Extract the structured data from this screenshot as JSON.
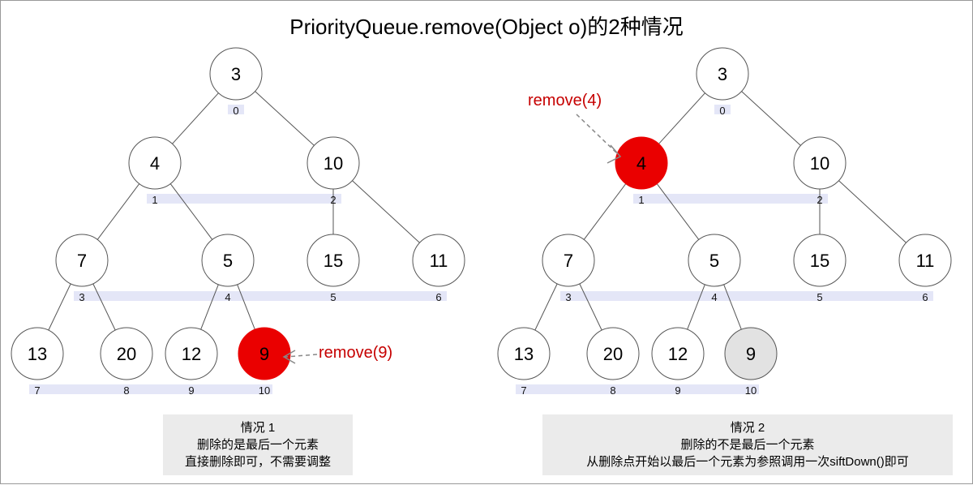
{
  "title": "PriorityQueue.remove(Object o)的2种情况",
  "left": {
    "nodes": [
      "3",
      "4",
      "10",
      "7",
      "5",
      "15",
      "11",
      "13",
      "20",
      "12",
      "9"
    ],
    "highlight_index": 10,
    "annotation": "remove(9)",
    "caption_title": "情况 1",
    "caption_line1": "删除的是最后一个元素",
    "caption_line2": "直接删除即可，不需要调整"
  },
  "right": {
    "nodes": [
      "3",
      "4",
      "10",
      "7",
      "5",
      "15",
      "11",
      "13",
      "20",
      "12",
      "9"
    ],
    "highlight_index": 1,
    "grey_index": 10,
    "annotation": "remove(4)",
    "caption_title": "情况 2",
    "caption_line1": "删除的不是最后一个元素",
    "caption_line2": "从删除点开始以最后一个元素为参照调用一次siftDown()即可"
  }
}
